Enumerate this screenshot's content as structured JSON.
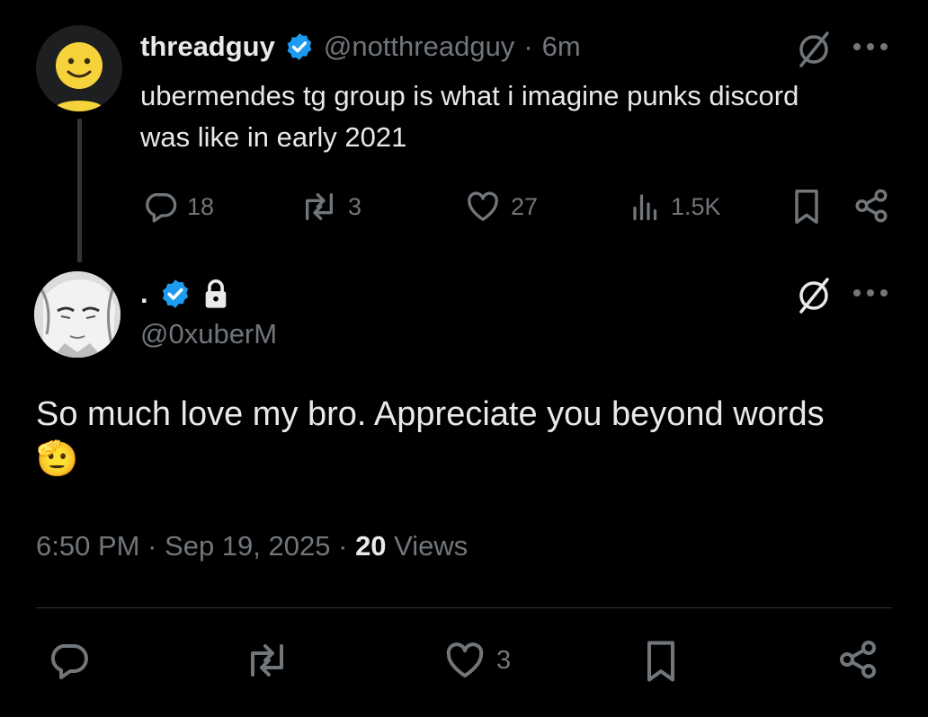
{
  "parent_tweet": {
    "display_name": "threadguy",
    "handle": "@notthreadguy",
    "separator": "·",
    "time_ago": "6m",
    "text": "ubermendes tg group is what i imagine punks discord was like in early 2021",
    "stats": {
      "replies": "18",
      "reposts": "3",
      "likes": "27",
      "views": "1.5K"
    }
  },
  "main_tweet": {
    "display_name": ".",
    "handle": "@0xuberM",
    "text": "So much love my bro. Appreciate you beyond words",
    "emoji": "🫡",
    "time": "6:50 PM",
    "separator": "·",
    "date": "Sep 19, 2025",
    "views_count": "20",
    "views_label": "Views",
    "stats": {
      "likes": "3"
    }
  },
  "colors": {
    "background": "#000000",
    "text": "#e7e9ea",
    "muted": "#71767b",
    "verified": "#1d9bf0",
    "divider": "#2f3336"
  },
  "icons": [
    "more-icon",
    "grok-icon",
    "reply-icon",
    "repost-icon",
    "like-icon",
    "views-icon",
    "bookmark-icon",
    "share-icon",
    "verified-badge-icon",
    "lock-icon"
  ]
}
